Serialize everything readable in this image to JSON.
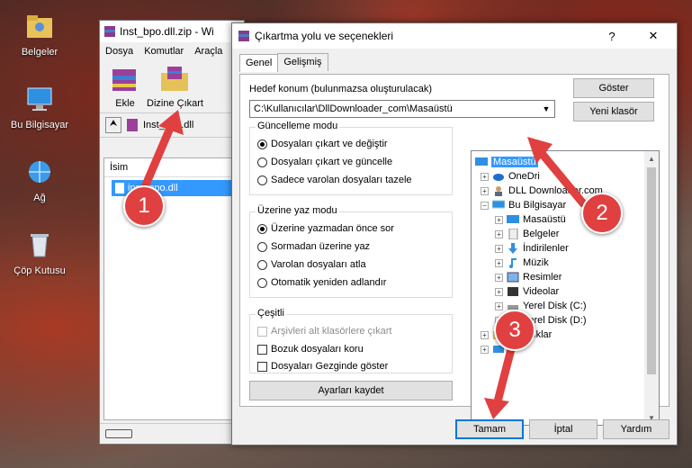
{
  "desktop": {
    "icons": [
      {
        "label": "Belgeler",
        "icon": "folder-user-icon"
      },
      {
        "label": "Bu Bilgisayar",
        "icon": "computer-icon"
      },
      {
        "label": "Ağ",
        "icon": "network-icon"
      },
      {
        "label": "Çöp Kutusu",
        "icon": "recycle-bin-icon"
      }
    ]
  },
  "archive_window": {
    "title": "Inst_bpo.dll.zip - Wi",
    "menu": [
      "Dosya",
      "Komutlar",
      "Araçla"
    ],
    "tools": [
      "Ekle",
      "Dizine Çıkart"
    ],
    "address": "Inst_bpo.dll",
    "column_header": "İsim",
    "file_row": "inst_bpo.dll"
  },
  "dialog": {
    "title": "Çıkartma yolu ve seçenekleri",
    "help_glyph": "?",
    "close_glyph": "✕",
    "tabs": [
      "Genel",
      "Gelişmiş"
    ],
    "dest_label": "Hedef konum (bulunmazsa oluşturulacak)",
    "dest_value": "C:\\Kullanıcılar\\DllDownloader_com\\Masaüstü",
    "show_button": "Göster",
    "new_folder_button": "Yeni klasör",
    "update_group": {
      "title": "Güncelleme modu",
      "options": [
        {
          "label": "Dosyaları çıkart ve değiştir",
          "checked": true
        },
        {
          "label": "Dosyaları çıkart ve güncelle",
          "checked": false
        },
        {
          "label": "Sadece varolan dosyaları tazele",
          "checked": false
        }
      ]
    },
    "overwrite_group": {
      "title": "Üzerine yaz modu",
      "options": [
        {
          "label": "Üzerine yazmadan önce sor",
          "checked": true
        },
        {
          "label": "Sormadan üzerine yaz",
          "checked": false
        },
        {
          "label": "Varolan dosyaları atla",
          "checked": false
        },
        {
          "label": "Otomatik yeniden adlandır",
          "checked": false
        }
      ]
    },
    "misc_group": {
      "title": "Çeşitli",
      "options": [
        {
          "label": "Arşivleri alt klasörlere çıkart",
          "checked": false,
          "disabled": true
        },
        {
          "label": "Bozuk dosyaları koru",
          "checked": false,
          "disabled": false
        },
        {
          "label": "Dosyaları Gezginde göster",
          "checked": false,
          "disabled": false
        }
      ]
    },
    "save_settings_button": "Ayarları kaydet",
    "tree": [
      {
        "label": "Masaüstü",
        "selected": true,
        "icon": "desktop-icon"
      },
      {
        "label": "OneDri",
        "icon": "cloud-icon"
      },
      {
        "label": "DLL Downloader.com",
        "icon": "user-icon"
      },
      {
        "label": "Bu Bilgisayar",
        "icon": "computer-icon"
      },
      {
        "label": "Masaüstü",
        "icon": "desktop-icon"
      },
      {
        "label": "Belgeler",
        "icon": "documents-icon"
      },
      {
        "label": "İndirilenler",
        "icon": "download-icon"
      },
      {
        "label": "Müzik",
        "icon": "music-icon"
      },
      {
        "label": "Resimler",
        "icon": "pictures-icon"
      },
      {
        "label": "Videolar",
        "icon": "videos-icon"
      },
      {
        "label": "Yerel Disk (C:)",
        "icon": "drive-icon"
      },
      {
        "label": "Yerel Disk (D:)",
        "icon": "drive-icon"
      },
      {
        "label": "Kitaplıklar",
        "icon": "libraries-icon"
      },
      {
        "label": "",
        "icon": "network-icon"
      }
    ],
    "ok_button": "Tamam",
    "cancel_button": "İptal",
    "help_button": "Yardım"
  },
  "callouts": [
    "1",
    "2",
    "3"
  ],
  "colors": {
    "callout": "#e04040",
    "selection": "#3399ff"
  }
}
